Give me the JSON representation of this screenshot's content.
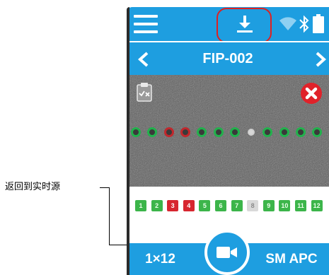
{
  "callout": {
    "text": "返回到实时源"
  },
  "header": {
    "icons": [
      "hamburger-menu-icon",
      "download-icon",
      "wifi-icon",
      "bluetooth-icon",
      "battery-icon"
    ],
    "highlight_color": "#e02020"
  },
  "title_bar": {
    "title": "FIP-002"
  },
  "image_view": {
    "icons": [
      "clipboard-fail-icon",
      "close-icon"
    ],
    "fibers": [
      "pass",
      "pass",
      "fail",
      "fail",
      "pass",
      "pass",
      "pass",
      "none",
      "pass",
      "pass",
      "pass",
      "pass"
    ]
  },
  "results": [
    {
      "label": "1",
      "status": "pass"
    },
    {
      "label": "2",
      "status": "pass"
    },
    {
      "label": "3",
      "status": "fail"
    },
    {
      "label": "4",
      "status": "fail"
    },
    {
      "label": "5",
      "status": "pass"
    },
    {
      "label": "6",
      "status": "pass"
    },
    {
      "label": "7",
      "status": "pass"
    },
    {
      "label": "8",
      "status": "none"
    },
    {
      "label": "9",
      "status": "pass"
    },
    {
      "label": "10",
      "status": "pass"
    },
    {
      "label": "11",
      "status": "pass"
    },
    {
      "label": "12",
      "status": "pass"
    }
  ],
  "bottom_bar": {
    "fiber_count": "1×12",
    "connector_type": "SM APC",
    "live_button_icon": "video-camera-icon"
  },
  "colors": {
    "accent": "#1e9ee0",
    "pass": "#3cb54a",
    "fail": "#d7262f",
    "none": "#d9d9d9"
  }
}
